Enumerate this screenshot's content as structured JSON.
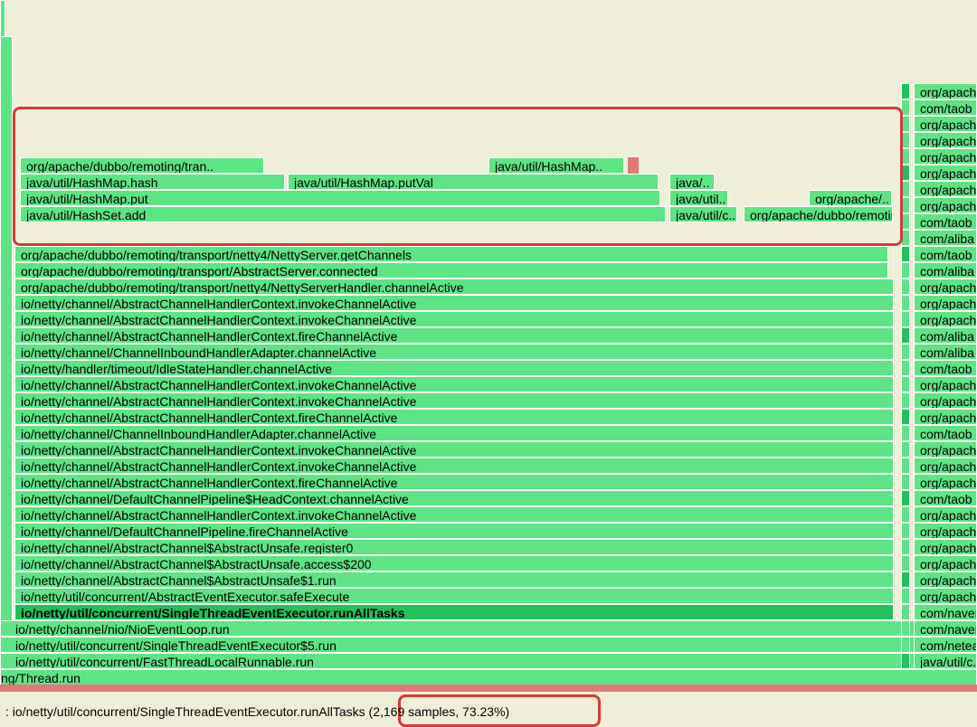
{
  "status_prefix": ": ",
  "status_method": "io/netty/util/concurrent/SingleThreadEventExecutor.runAllTasks",
  "status_detail": " (2,169 samples, 73.23%)",
  "main_stack": [
    "ng/Thread.run",
    "io/netty/util/concurrent/FastThreadLocalRunnable.run",
    "io/netty/util/concurrent/SingleThreadEventExecutor$5.run",
    "io/netty/channel/nio/NioEventLoop.run",
    "io/netty/util/concurrent/SingleThreadEventExecutor.runAllTasks",
    "io/netty/util/concurrent/AbstractEventExecutor.safeExecute",
    "io/netty/channel/AbstractChannel$AbstractUnsafe$1.run",
    "io/netty/channel/AbstractChannel$AbstractUnsafe.access$200",
    "io/netty/channel/AbstractChannel$AbstractUnsafe.register0",
    "io/netty/channel/DefaultChannelPipeline.fireChannelActive",
    "io/netty/channel/AbstractChannelHandlerContext.invokeChannelActive",
    "io/netty/channel/DefaultChannelPipeline$HeadContext.channelActive",
    "io/netty/channel/AbstractChannelHandlerContext.fireChannelActive",
    "io/netty/channel/AbstractChannelHandlerContext.invokeChannelActive",
    "io/netty/channel/AbstractChannelHandlerContext.invokeChannelActive",
    "io/netty/channel/ChannelInboundHandlerAdapter.channelActive",
    "io/netty/channel/AbstractChannelHandlerContext.fireChannelActive",
    "io/netty/channel/AbstractChannelHandlerContext.invokeChannelActive",
    "io/netty/channel/AbstractChannelHandlerContext.invokeChannelActive",
    "io/netty/handler/timeout/IdleStateHandler.channelActive",
    "io/netty/channel/ChannelInboundHandlerAdapter.channelActive",
    "io/netty/channel/AbstractChannelHandlerContext.fireChannelActive",
    "io/netty/channel/AbstractChannelHandlerContext.invokeChannelActive",
    "io/netty/channel/AbstractChannelHandlerContext.invokeChannelActive",
    "org/apache/dubbo/remoting/transport/netty4/NettyServerHandler.channelActive",
    "org/apache/dubbo/remoting/transport/AbstractServer.connected",
    "org/apache/dubbo/remoting/transport/netty4/NettyServer.getChannels"
  ],
  "hotspot": {
    "r0_a": "java/util/HashSet.add",
    "r0_b": "java/util/c..",
    "r0_c": "org/apache/dubbo/remoting/..",
    "r1_a": "java/util/HashMap.put",
    "r1_b": "java/util..",
    "r1_c": "org/apache/..",
    "r2_a": "java/util/HashMap.hash",
    "r2_b": "java/util/HashMap.putVal",
    "r2_c": "java/..",
    "r3_a": "org/apache/dubbo/remoting/tran..",
    "r3_b": "java/util/HashMap.."
  },
  "right_stack": [
    "java/util/c..",
    "com/netease",
    "com/naverc",
    "com/naverc",
    "org/apach",
    "org/apach",
    "org/apach",
    "org/apach",
    "org/apach",
    "org/apach",
    "com/taob",
    "org/apach",
    "org/apach",
    "org/apach",
    "com/taob",
    "org/apach",
    "org/apach",
    "org/apach",
    "com/taob",
    "com/aliba",
    "com/aliba",
    "org/apach",
    "org/apach",
    "org/apach",
    "com/aliba",
    "com/taob",
    "com/aliba",
    "com/taob",
    "org/apach",
    "org/apach",
    "org/apach",
    "org/apach",
    "org/apach",
    "org/apach",
    "com/taob",
    "org/apach"
  ]
}
